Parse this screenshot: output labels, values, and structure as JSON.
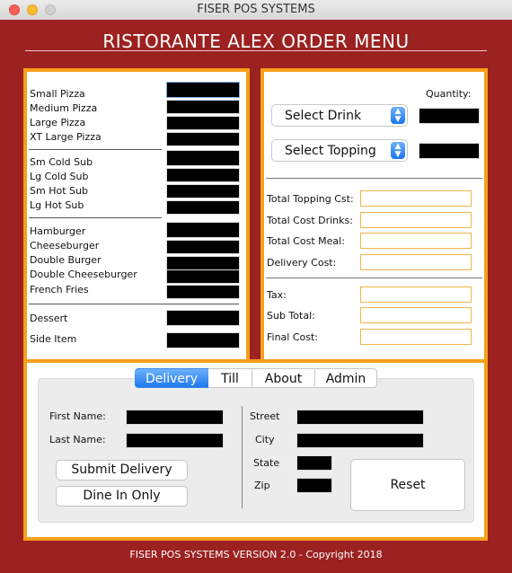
{
  "window": {
    "title": "FISER POS SYSTEMS"
  },
  "app": {
    "title": "RISTORANTE ALEX ORDER MENU",
    "footer": "FISER POS SYSTEMS VERSION 2.0 - Copyright 2018"
  },
  "menu": {
    "pizza": [
      "Small Pizza",
      "Medium Pizza",
      "Large Pizza",
      "XT Large Pizza"
    ],
    "subs": [
      "Sm Cold Sub",
      "Lg Cold Sub",
      "Sm Hot Sub",
      "Lg Hot Sub"
    ],
    "burgers": [
      "Hamburger",
      "Cheeseburger",
      "Double Burger",
      "Double Cheeseburger",
      "French Fries"
    ],
    "extras": [
      "Dessert",
      "Side Item"
    ]
  },
  "orders": {
    "quantity_label": "Quantity:",
    "drink_select": "Select Drink",
    "topping_select": "Select Topping",
    "totals": [
      "Total Topping Cst:",
      "Total Cost Drinks:",
      "Total Cost Meal:",
      "Delivery Cost:"
    ],
    "final": [
      "Tax:",
      "Sub Total:",
      "Final Cost:"
    ]
  },
  "tabs": [
    "Delivery",
    "Till",
    "About",
    "Admin"
  ],
  "delivery": {
    "first_name_label": "First Name:",
    "last_name_label": "Last Name:",
    "street_label": "Street",
    "city_label": "City",
    "state_label": "State",
    "zip_label": "Zip",
    "submit_button": "Submit Delivery",
    "dine_in_button": "Dine In Only",
    "reset_button": "Reset"
  },
  "colors": {
    "background": "#9c2121",
    "panel_border": "#f5a01b",
    "accent": "#1f78ef"
  }
}
